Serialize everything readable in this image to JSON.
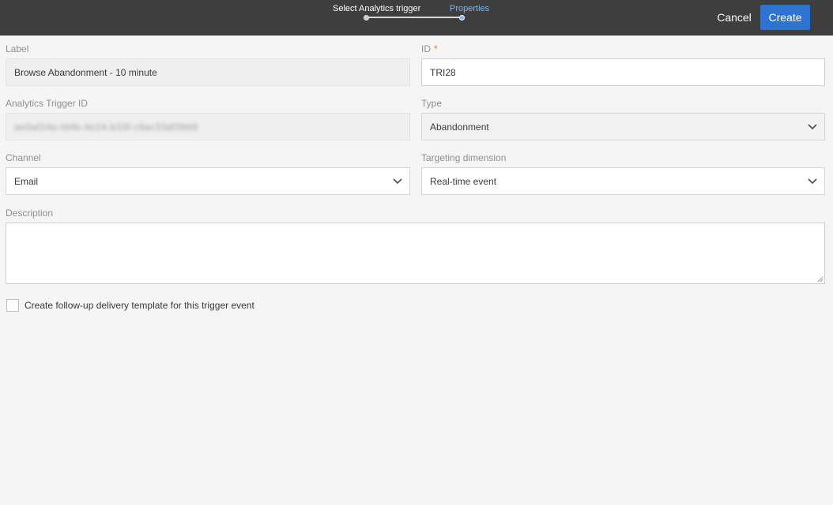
{
  "wizard": {
    "steps": [
      {
        "label": "Select Analytics trigger",
        "state": "completed"
      },
      {
        "label": "Properties",
        "state": "current"
      }
    ],
    "cancel_label": "Cancel",
    "create_label": "Create",
    "accent_color": "#2d73cf",
    "active_step_color": "#7eb6f2"
  },
  "form": {
    "label": {
      "label": "Label",
      "value": "Browse Abandonment - 10 minute"
    },
    "id": {
      "label": "ID",
      "required_mark": "*",
      "value": "TRI28"
    },
    "analytics_trigger_id": {
      "label": "Analytics Trigger ID",
      "value": "ae0af24a-fd4b-4e24-b33f-c9ac33df3bb9"
    },
    "type": {
      "label": "Type",
      "value": "Abandonment"
    },
    "channel": {
      "label": "Channel",
      "value": "Email"
    },
    "targeting_dimension": {
      "label": "Targeting dimension",
      "value": "Real-time event"
    },
    "description": {
      "label": "Description",
      "value": ""
    },
    "follow_up": {
      "label": "Create follow-up delivery template for this trigger event",
      "checked": false
    }
  }
}
